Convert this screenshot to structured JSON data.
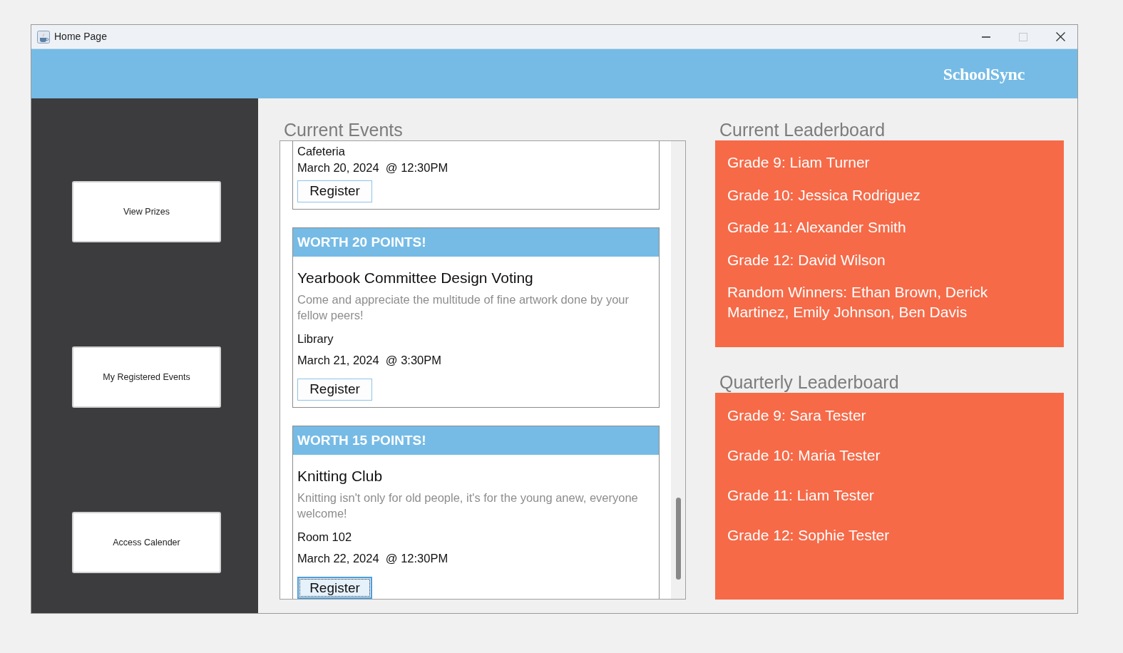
{
  "window": {
    "title": "Home Page",
    "controls": [
      {
        "kind": "minimize",
        "disabled": false
      },
      {
        "kind": "maximize",
        "disabled": true
      },
      {
        "kind": "close",
        "disabled": false
      }
    ]
  },
  "header": {
    "brand": "SchoolSync"
  },
  "sidebar": {
    "buttons": [
      "View Prizes",
      "My Registered Events",
      "Access Calender"
    ]
  },
  "current_events": {
    "heading": "Current Events",
    "events": [
      {
        "location": "Cafeteria",
        "date": "March 20, 2024  @ 12:30PM",
        "button": "Register",
        "focused": false
      },
      {
        "points": "WORTH 20 POINTS!",
        "title": "Yearbook Committee Design Voting",
        "description": "Come and appreciate the multitude of fine artwork done by your fellow peers!",
        "location": "Library",
        "date": "March 21, 2024  @ 3:30PM",
        "button": "Register",
        "focused": false
      },
      {
        "points": "WORTH 15 POINTS!",
        "title": "Knitting Club",
        "description": "Knitting isn't only for old people, it's for the young anew, everyone welcome!",
        "location": "Room 102",
        "date": "March 22, 2024  @ 12:30PM",
        "button": "Register",
        "focused": true
      }
    ]
  },
  "current_leaderboard": {
    "heading": "Current Leaderboard",
    "entries": [
      "Grade 9: Liam Turner",
      "Grade 10: Jessica Rodriguez",
      "Grade 11: Alexander Smith",
      "Grade 12: David Wilson",
      "Random Winners: Ethan Brown, Derick Martinez, Emily Johnson, Ben Davis"
    ]
  },
  "quarterly_leaderboard": {
    "heading": "Quarterly Leaderboard",
    "entries": [
      "Grade 9: Sara Tester",
      "Grade 10: Maria Tester",
      "Grade 11: Liam Tester",
      "Grade 12: Sophie Tester"
    ]
  }
}
